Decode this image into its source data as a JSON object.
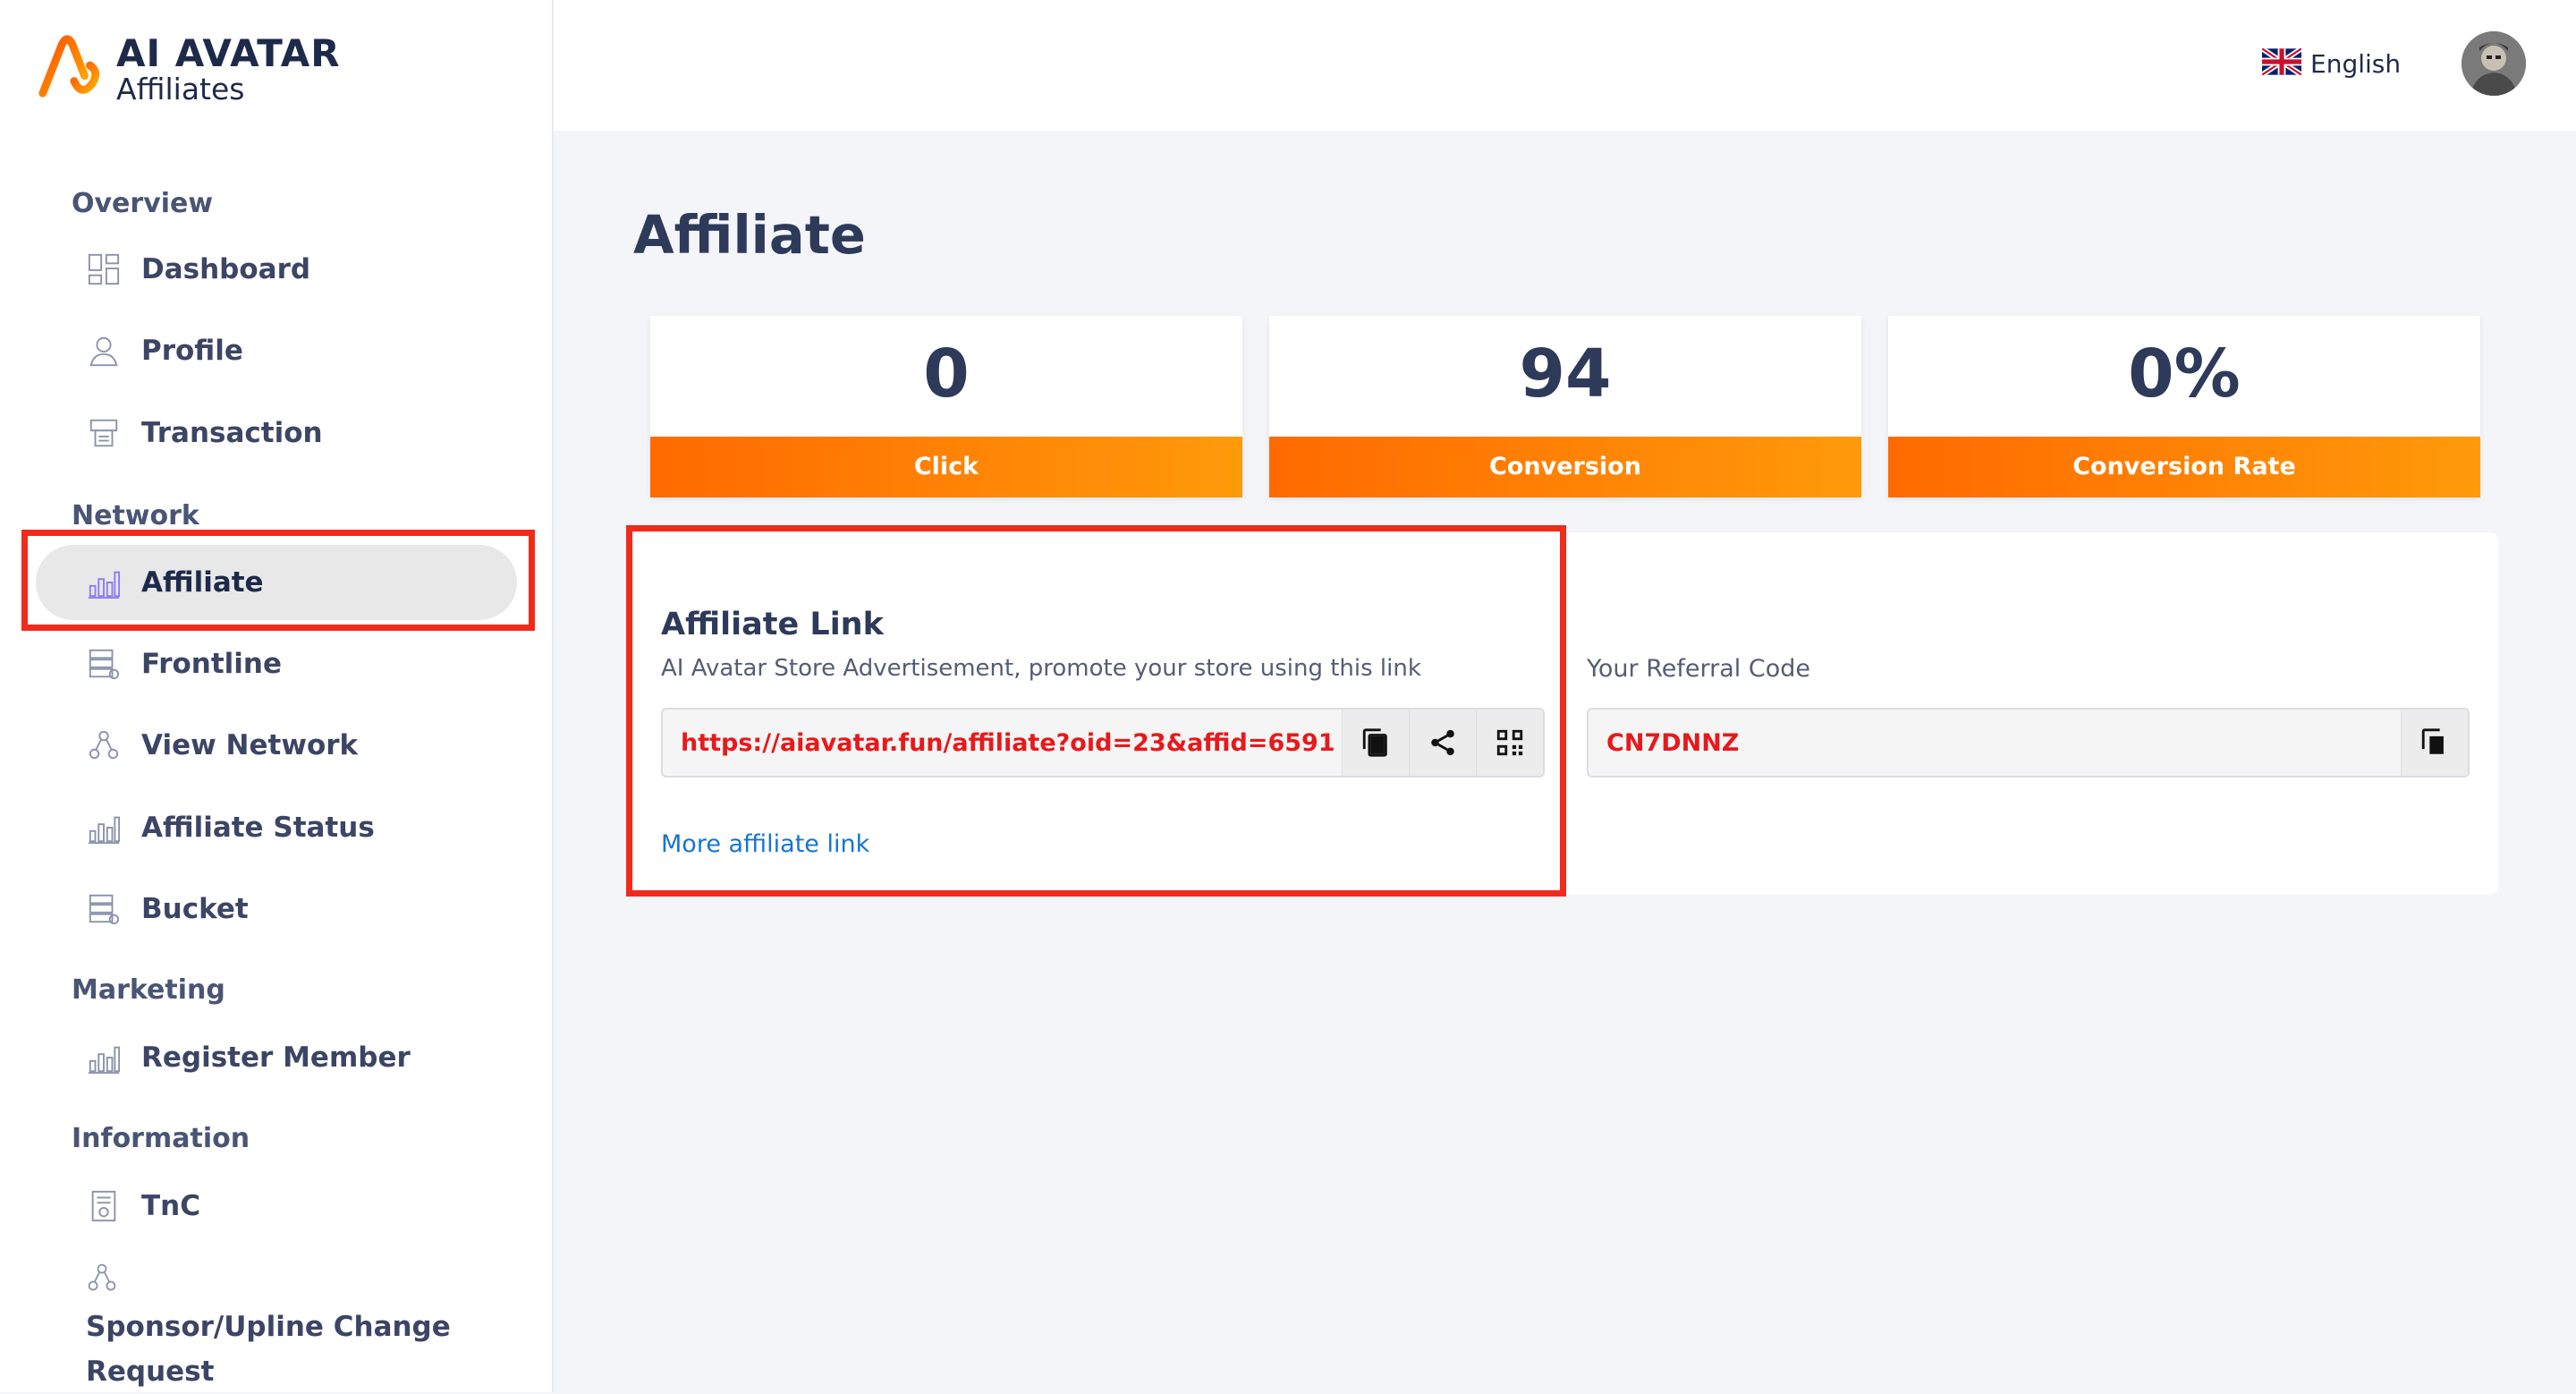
{
  "brand": {
    "title": "AI AVATAR",
    "subtitle": "Affiliates"
  },
  "sidebar": {
    "sections": [
      {
        "label": "Overview"
      },
      {
        "label": "Network"
      },
      {
        "label": "Marketing"
      },
      {
        "label": "Information"
      }
    ],
    "items": [
      {
        "label": "Dashboard",
        "icon": "dashboard-icon"
      },
      {
        "label": "Profile",
        "icon": "user-icon"
      },
      {
        "label": "Transaction",
        "icon": "printer-icon"
      },
      {
        "label": "Affiliate",
        "icon": "bar-chart-icon",
        "active": true
      },
      {
        "label": "Frontline",
        "icon": "list-icon"
      },
      {
        "label": "View Network",
        "icon": "network-icon"
      },
      {
        "label": "Affiliate Status",
        "icon": "bar-chart-icon"
      },
      {
        "label": "Bucket",
        "icon": "list-icon"
      },
      {
        "label": "Register Member",
        "icon": "bar-chart-icon"
      },
      {
        "label": "TnC",
        "icon": "document-icon"
      },
      {
        "label": "Sponsor/Upline Change Request",
        "label_line1": "Sponsor/Upline Change",
        "label_line2": "Request",
        "icon": "network-icon"
      }
    ]
  },
  "header": {
    "language": "English",
    "language_icon": "uk-flag-icon",
    "avatar_icon": "avatar-icon"
  },
  "main": {
    "title": "Affiliate",
    "stats": [
      {
        "value": "0",
        "label": "Click"
      },
      {
        "value": "94",
        "label": "Conversion"
      },
      {
        "value": "0%",
        "label": "Conversion Rate"
      }
    ],
    "affiliate_link": {
      "title": "Affiliate Link",
      "description": "AI Avatar Store Advertisement, promote your store using this link",
      "url": "https://aiavatar.fun/affiliate?oid=23&affid=6591",
      "more_label": "More affiliate link"
    },
    "referral": {
      "label": "Your Referral Code",
      "code": "CN7DNNZ"
    }
  },
  "colors": {
    "accent_orange": "#ff7a00",
    "highlight_red": "#f22a1a",
    "link_blue": "#1675d1",
    "value_red": "#e8191b"
  }
}
